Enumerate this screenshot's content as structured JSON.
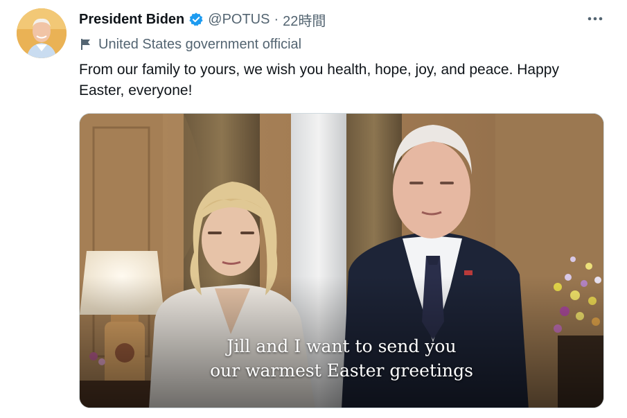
{
  "tweet": {
    "author_name": "President Biden",
    "handle": "@POTUS",
    "separator": "·",
    "time": "22時間",
    "label": "United States government official",
    "text": "From our family to yours, we wish you health, hope, joy, and peace. Happy Easter, everyone!",
    "media": {
      "caption_line1": "Jill and I want to send you",
      "caption_line2": "our warmest Easter greetings"
    }
  },
  "colors": {
    "verified_badge": "#1d9bf0",
    "secondary_text": "#536471",
    "primary_text": "#0f1419"
  },
  "icons": {
    "verified": "verified-badge-icon",
    "label_flag": "flag-icon",
    "more": "more-horizontal-icon"
  }
}
